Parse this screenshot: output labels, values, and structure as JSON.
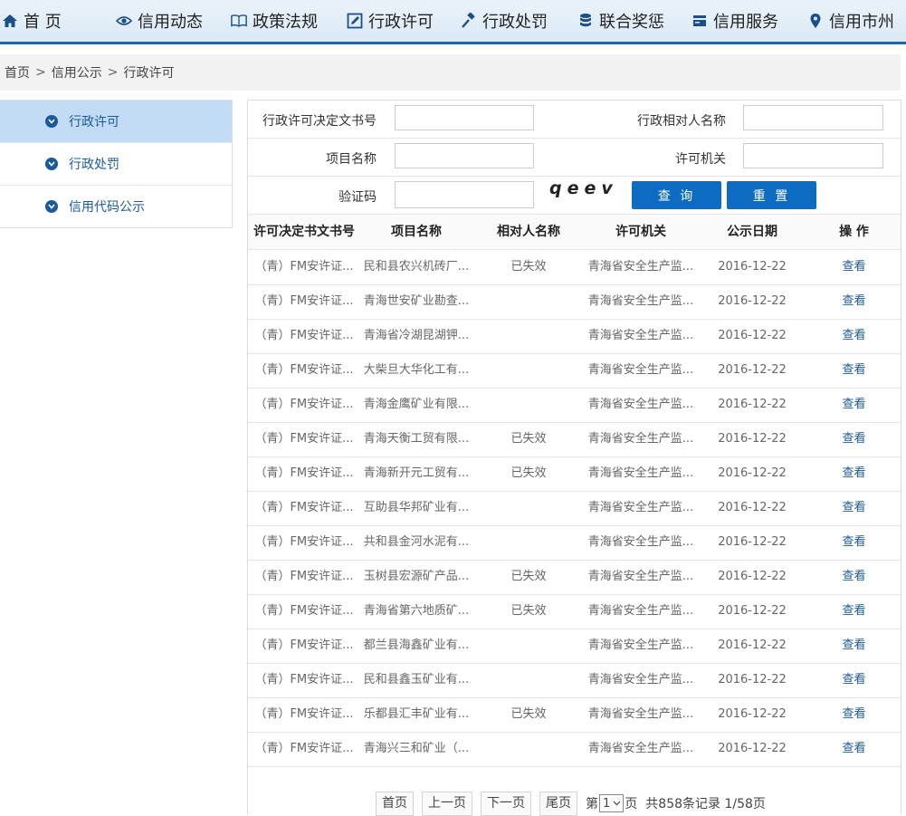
{
  "nav": {
    "items": [
      {
        "label": "首 页",
        "icon": "home-icon"
      },
      {
        "label": "信用动态",
        "icon": "eye-icon"
      },
      {
        "label": "政策法规",
        "icon": "book-icon"
      },
      {
        "label": "行政许可",
        "icon": "edit-icon"
      },
      {
        "label": "行政处罚",
        "icon": "gavel-icon"
      },
      {
        "label": "联合奖惩",
        "icon": "database-icon"
      },
      {
        "label": "信用服务",
        "icon": "card-icon"
      },
      {
        "label": "信用市州",
        "icon": "map-marker-icon"
      }
    ]
  },
  "breadcrumb": {
    "home": "首页",
    "section": "信用公示",
    "current": "行政许可",
    "sep": ">"
  },
  "sidebar": {
    "items": [
      {
        "label": "行政许可",
        "active": true
      },
      {
        "label": "行政处罚",
        "active": false
      },
      {
        "label": "信用代码公示",
        "active": false
      }
    ]
  },
  "search": {
    "doc_no_label": "行政许可决定文书号",
    "party_name_label": "行政相对人名称",
    "project_name_label": "项目名称",
    "authority_label": "许可机关",
    "captcha_label": "验证码",
    "captcha_text": "qeev",
    "query_button": "查 询",
    "reset_button": "重 置"
  },
  "table": {
    "headers": [
      "许可决定书文书号",
      "项目名称",
      "相对人名称",
      "许可机关",
      "公示日期",
      "操 作"
    ],
    "rows": [
      {
        "doc": "（青）FM安许证...",
        "project": "民和县农兴机砖厂...",
        "party": "已失效",
        "authority": "青海省安全生产监...",
        "date": "2016-12-22",
        "op": "查看"
      },
      {
        "doc": "（青）FM安许证...",
        "project": "青海世安矿业勘查...",
        "party": "",
        "authority": "青海省安全生产监...",
        "date": "2016-12-22",
        "op": "查看"
      },
      {
        "doc": "（青）FM安许证...",
        "project": "青海省冷湖昆湖钾...",
        "party": "",
        "authority": "青海省安全生产监...",
        "date": "2016-12-22",
        "op": "查看"
      },
      {
        "doc": "（青）FM安许证...",
        "project": "大柴旦大华化工有...",
        "party": "",
        "authority": "青海省安全生产监...",
        "date": "2016-12-22",
        "op": "查看"
      },
      {
        "doc": "（青）FM安许证...",
        "project": "青海金鹰矿业有限...",
        "party": "",
        "authority": "青海省安全生产监...",
        "date": "2016-12-22",
        "op": "查看"
      },
      {
        "doc": "（青）FM安许证...",
        "project": "青海天衡工贸有限...",
        "party": "已失效",
        "authority": "青海省安全生产监...",
        "date": "2016-12-22",
        "op": "查看"
      },
      {
        "doc": "（青）FM安许证...",
        "project": "青海新开元工贸有...",
        "party": "已失效",
        "authority": "青海省安全生产监...",
        "date": "2016-12-22",
        "op": "查看"
      },
      {
        "doc": "（青）FM安许证...",
        "project": "互助县华邦矿业有...",
        "party": "",
        "authority": "青海省安全生产监...",
        "date": "2016-12-22",
        "op": "查看"
      },
      {
        "doc": "（青）FM安许证...",
        "project": "共和县金河水泥有...",
        "party": "",
        "authority": "青海省安全生产监...",
        "date": "2016-12-22",
        "op": "查看"
      },
      {
        "doc": "（青）FM安许证...",
        "project": "玉树县宏源矿产品...",
        "party": "已失效",
        "authority": "青海省安全生产监...",
        "date": "2016-12-22",
        "op": "查看"
      },
      {
        "doc": "（青）FM安许证...",
        "project": "青海省第六地质矿...",
        "party": "已失效",
        "authority": "青海省安全生产监...",
        "date": "2016-12-22",
        "op": "查看"
      },
      {
        "doc": "（青）FM安许证...",
        "project": "都兰县海鑫矿业有...",
        "party": "",
        "authority": "青海省安全生产监...",
        "date": "2016-12-22",
        "op": "查看"
      },
      {
        "doc": "（青）FM安许证...",
        "project": "民和县鑫玉矿业有...",
        "party": "",
        "authority": "青海省安全生产监...",
        "date": "2016-12-22",
        "op": "查看"
      },
      {
        "doc": "（青）FM安许证...",
        "project": "乐都县汇丰矿业有...",
        "party": "已失效",
        "authority": "青海省安全生产监...",
        "date": "2016-12-22",
        "op": "查看"
      },
      {
        "doc": "（青）FM安许证...",
        "project": "青海兴三和矿业（...",
        "party": "",
        "authority": "青海省安全生产监...",
        "date": "2016-12-22",
        "op": "查看"
      }
    ]
  },
  "pager": {
    "first": "首页",
    "prev": "上一页",
    "next": "下一页",
    "last": "尾页",
    "page_prefix": "第",
    "current_page": "1",
    "page_suffix": "页",
    "summary": "共858条记录 1/58页"
  },
  "colors": {
    "accent": "#1f66b1",
    "button": "#0d6cc2",
    "link": "#1b5a99",
    "sidebar_active": "#c3dcf5"
  }
}
